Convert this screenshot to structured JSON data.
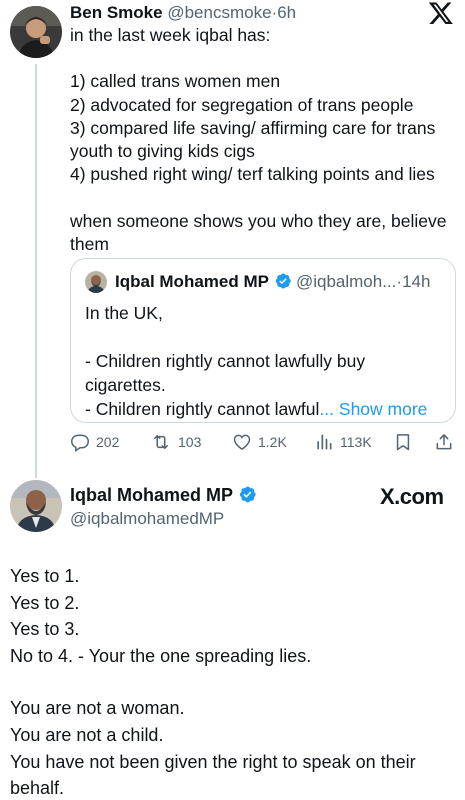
{
  "tweet": {
    "author_name": "Ben Smoke",
    "author_handle": "@bencsmoke",
    "separator": "·",
    "time": "6h",
    "intro": "in the last week iqbal has:",
    "points": [
      "1)  called trans women men",
      "2) advocated for segregation of trans people",
      "3) compared life saving/ affirming care for trans youth to giving kids cigs",
      "4) pushed right wing/ terf talking points and lies"
    ],
    "closing": "when someone shows you who they are, believe them",
    "quote": {
      "author_name": "Iqbal Mohamed MP",
      "author_handle": "@iqbalmoh...",
      "separator": "·",
      "time": "14h",
      "lines": [
        "In the UK,",
        "",
        "- Children rightly cannot lawfully buy cigarettes.",
        "- Children rightly cannot lawful"
      ],
      "ellipsis": "...",
      "show_more": "Show more"
    },
    "stats": {
      "replies": "202",
      "retweets": "103",
      "likes": "1.2K",
      "views": "113K"
    }
  },
  "reply": {
    "author_name": "Iqbal Mohamed MP",
    "author_handle": "@iqbalmohamedMP",
    "watermark": "X.com",
    "lines_group1": [
      "Yes to 1.",
      "Yes to 2.",
      "Yes to 3.",
      "No to 4. - Your the one spreading lies."
    ],
    "lines_group2": [
      "You are not a woman.",
      "You are not a child.",
      "You have not been given the right to speak on their behalf."
    ]
  },
  "icons": {
    "x_logo": "x-logo-icon",
    "verified": "verified-badge-icon",
    "reply": "reply-icon",
    "retweet": "retweet-icon",
    "like": "like-icon",
    "views": "views-icon",
    "bookmark": "bookmark-icon",
    "share": "share-icon"
  },
  "colors": {
    "text": "#0f1419",
    "secondary": "#536471",
    "accent": "#1d9bf0",
    "border": "#cfd9de"
  }
}
